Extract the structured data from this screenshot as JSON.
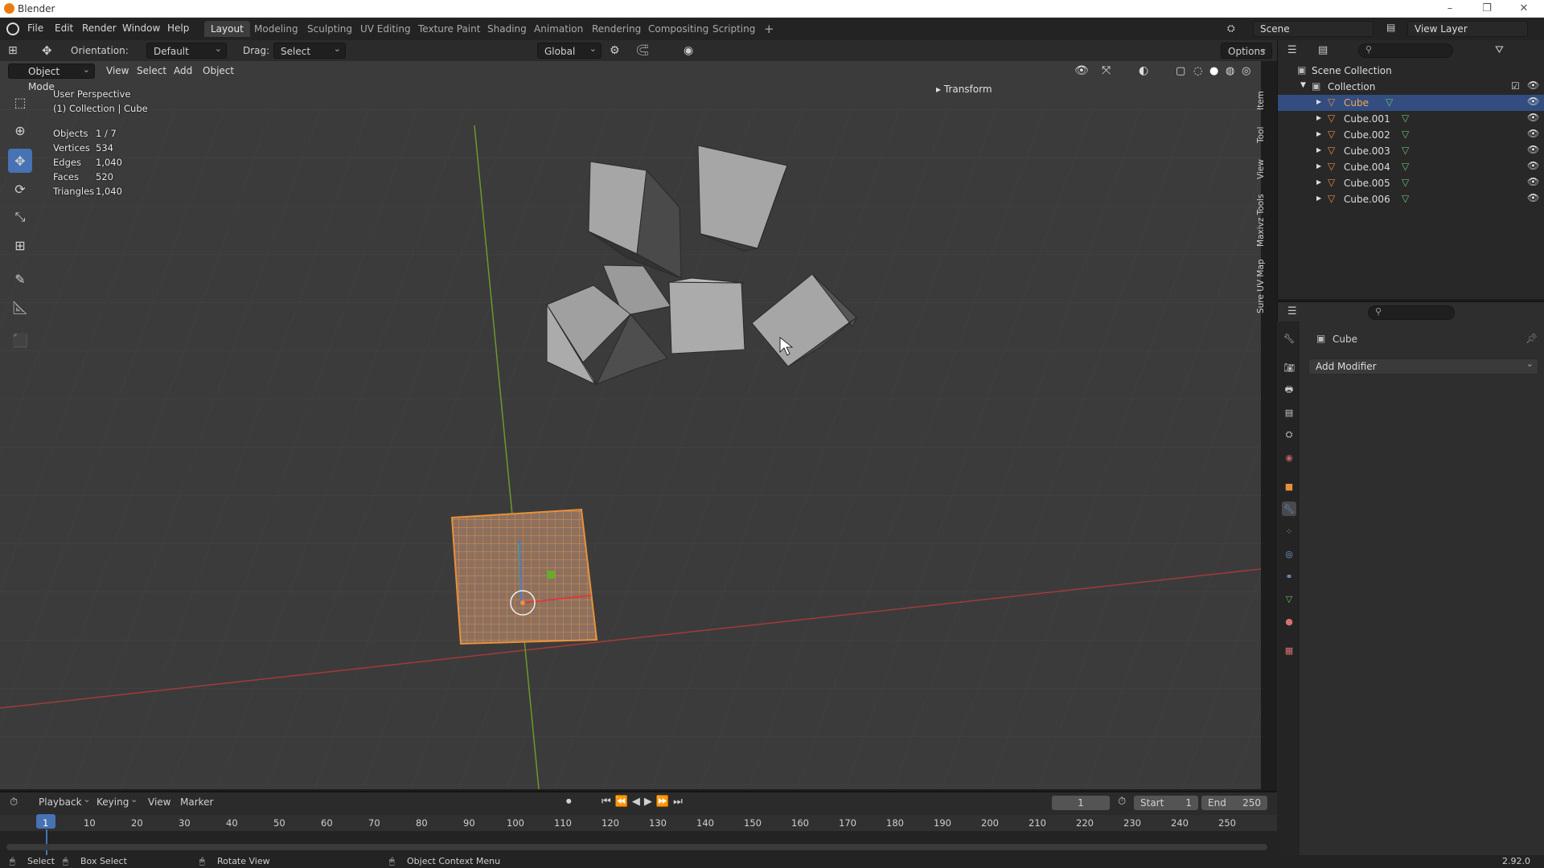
{
  "window": {
    "title": "Blender"
  },
  "menu": [
    "File",
    "Edit",
    "Render",
    "Window",
    "Help"
  ],
  "workspaces": [
    "Layout",
    "Modeling",
    "Sculpting",
    "UV Editing",
    "Texture Paint",
    "Shading",
    "Animation",
    "Rendering",
    "Compositing",
    "Scripting",
    "+"
  ],
  "scene": {
    "name": "Scene",
    "view_layer": "View Layer"
  },
  "toolheader": {
    "orientation_label": "Orientation:",
    "orientation_value": "Default",
    "drag_label": "Drag:",
    "drag_value": "Select Box",
    "transform_orient": "Global",
    "options": "Options"
  },
  "viewport_header": {
    "mode": "Object Mode",
    "view": "View",
    "select": "Select",
    "add": "Add",
    "object": "Object"
  },
  "overlay": {
    "perspective": "User Perspective",
    "collection": "(1) Collection | Cube",
    "stats": [
      {
        "label": "Objects",
        "value": "1 / 7"
      },
      {
        "label": "Vertices",
        "value": "534"
      },
      {
        "label": "Edges",
        "value": "1,040"
      },
      {
        "label": "Faces",
        "value": "520"
      },
      {
        "label": "Triangles",
        "value": "1,040"
      }
    ]
  },
  "sidebar_panel": {
    "transform": "Transform"
  },
  "side_tabs": [
    "Item",
    "Tool",
    "View",
    "Maxivz Tools",
    "Sure UV Map"
  ],
  "outliner": {
    "scene_collection": "Scene Collection",
    "collection": "Collection",
    "objects": [
      "Cube",
      "Cube.001",
      "Cube.002",
      "Cube.003",
      "Cube.004",
      "Cube.005",
      "Cube.006"
    ],
    "selected": "Cube"
  },
  "properties": {
    "object_name": "Cube",
    "add_modifier": "Add Modifier"
  },
  "timeline": {
    "menus": [
      "Playback",
      "Keying",
      "View",
      "Marker"
    ],
    "current_frame": "1",
    "start_label": "Start",
    "start": "1",
    "end_label": "End",
    "end": "250",
    "ticks": [
      "1",
      "10",
      "20",
      "30",
      "40",
      "50",
      "60",
      "70",
      "80",
      "90",
      "100",
      "110",
      "120",
      "130",
      "140",
      "150",
      "160",
      "170",
      "180",
      "190",
      "200",
      "210",
      "220",
      "230",
      "240",
      "250"
    ]
  },
  "status": {
    "select": "Select",
    "box_select": "Box Select",
    "rotate": "Rotate View",
    "context": "Object Context Menu",
    "version": "2.92.0"
  },
  "colors": {
    "accent": "#4772b3",
    "selection_orange": "#e8913b",
    "x_axis": "#c23b3b",
    "y_axis": "#6a9a2a"
  }
}
